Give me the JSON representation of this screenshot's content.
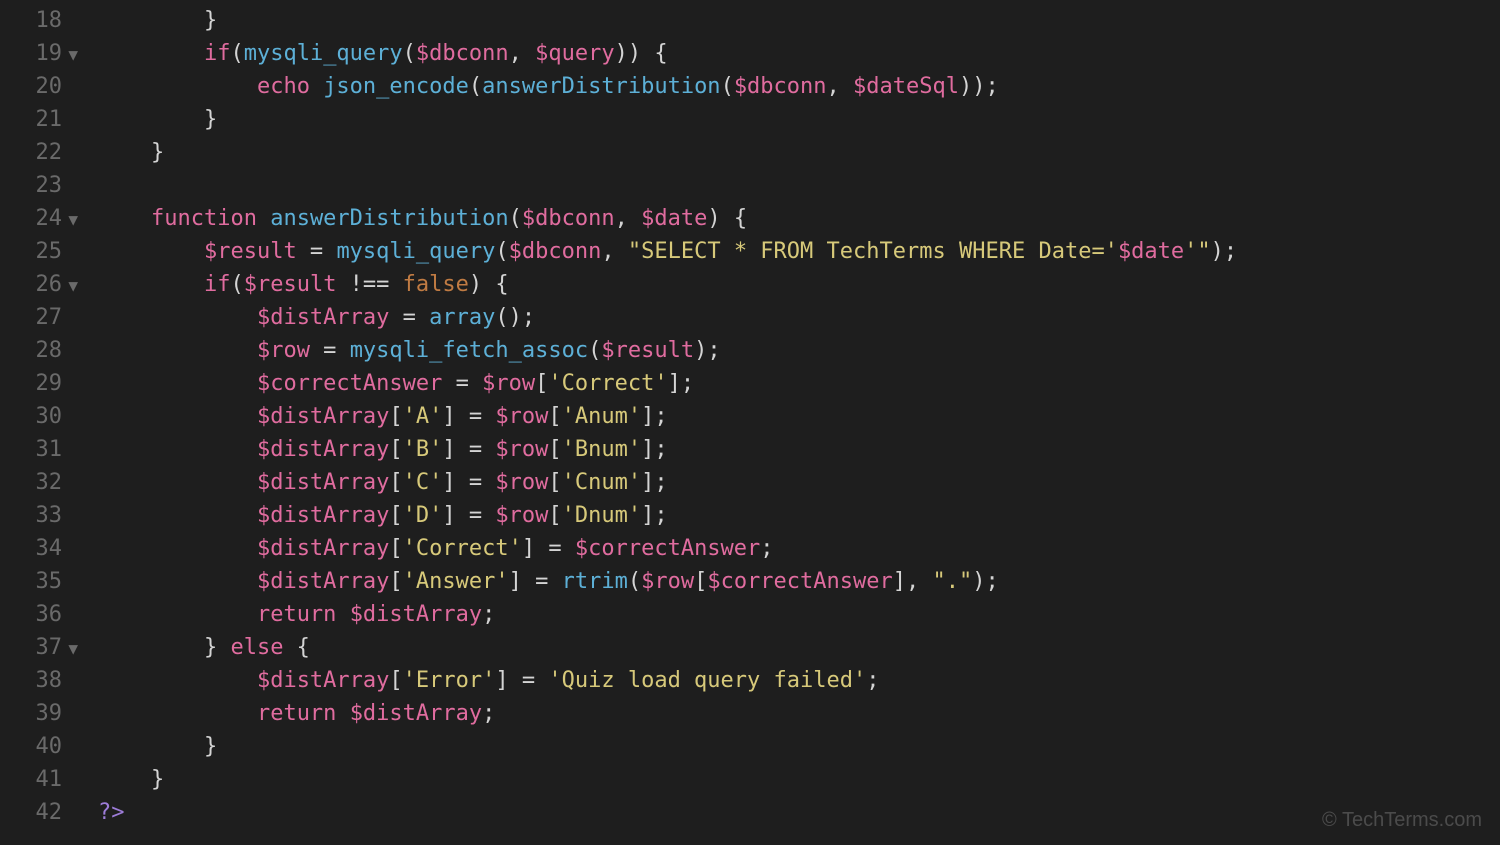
{
  "watermark": "© TechTerms.com",
  "gutter": [
    {
      "n": "18",
      "fold": ""
    },
    {
      "n": "19",
      "fold": "▼"
    },
    {
      "n": "20",
      "fold": ""
    },
    {
      "n": "21",
      "fold": ""
    },
    {
      "n": "22",
      "fold": ""
    },
    {
      "n": "23",
      "fold": ""
    },
    {
      "n": "24",
      "fold": "▼"
    },
    {
      "n": "25",
      "fold": ""
    },
    {
      "n": "26",
      "fold": "▼"
    },
    {
      "n": "27",
      "fold": ""
    },
    {
      "n": "28",
      "fold": ""
    },
    {
      "n": "29",
      "fold": ""
    },
    {
      "n": "30",
      "fold": ""
    },
    {
      "n": "31",
      "fold": ""
    },
    {
      "n": "32",
      "fold": ""
    },
    {
      "n": "33",
      "fold": ""
    },
    {
      "n": "34",
      "fold": ""
    },
    {
      "n": "35",
      "fold": ""
    },
    {
      "n": "36",
      "fold": ""
    },
    {
      "n": "37",
      "fold": "▼"
    },
    {
      "n": "38",
      "fold": ""
    },
    {
      "n": "39",
      "fold": ""
    },
    {
      "n": "40",
      "fold": ""
    },
    {
      "n": "41",
      "fold": ""
    },
    {
      "n": "42",
      "fold": ""
    }
  ],
  "lines": [
    [
      {
        "t": "        }",
        "c": "tok-default"
      }
    ],
    [
      {
        "t": "        ",
        "c": "tok-default"
      },
      {
        "t": "if",
        "c": "tok-keyword"
      },
      {
        "t": "(",
        "c": "tok-punct"
      },
      {
        "t": "mysqli_query",
        "c": "tok-func"
      },
      {
        "t": "(",
        "c": "tok-punct"
      },
      {
        "t": "$dbconn",
        "c": "tok-var"
      },
      {
        "t": ", ",
        "c": "tok-punct"
      },
      {
        "t": "$query",
        "c": "tok-var"
      },
      {
        "t": ")) {",
        "c": "tok-punct"
      }
    ],
    [
      {
        "t": "            ",
        "c": "tok-default"
      },
      {
        "t": "echo",
        "c": "tok-keyword"
      },
      {
        "t": " ",
        "c": "tok-default"
      },
      {
        "t": "json_encode",
        "c": "tok-func"
      },
      {
        "t": "(",
        "c": "tok-punct"
      },
      {
        "t": "answerDistribution",
        "c": "tok-func"
      },
      {
        "t": "(",
        "c": "tok-punct"
      },
      {
        "t": "$dbconn",
        "c": "tok-var"
      },
      {
        "t": ", ",
        "c": "tok-punct"
      },
      {
        "t": "$dateSql",
        "c": "tok-var"
      },
      {
        "t": "));",
        "c": "tok-punct"
      }
    ],
    [
      {
        "t": "        }",
        "c": "tok-default"
      }
    ],
    [
      {
        "t": "    }",
        "c": "tok-default"
      }
    ],
    [
      {
        "t": "",
        "c": "tok-default"
      }
    ],
    [
      {
        "t": "    ",
        "c": "tok-default"
      },
      {
        "t": "function",
        "c": "tok-keyword"
      },
      {
        "t": " ",
        "c": "tok-default"
      },
      {
        "t": "answerDistribution",
        "c": "tok-funcdef"
      },
      {
        "t": "(",
        "c": "tok-punct"
      },
      {
        "t": "$dbconn",
        "c": "tok-var"
      },
      {
        "t": ", ",
        "c": "tok-punct"
      },
      {
        "t": "$date",
        "c": "tok-var"
      },
      {
        "t": ") {",
        "c": "tok-punct"
      }
    ],
    [
      {
        "t": "        ",
        "c": "tok-default"
      },
      {
        "t": "$result",
        "c": "tok-var"
      },
      {
        "t": " = ",
        "c": "tok-op"
      },
      {
        "t": "mysqli_query",
        "c": "tok-func"
      },
      {
        "t": "(",
        "c": "tok-punct"
      },
      {
        "t": "$dbconn",
        "c": "tok-var"
      },
      {
        "t": ", ",
        "c": "tok-punct"
      },
      {
        "t": "\"SELECT * FROM TechTerms WHERE Date='",
        "c": "tok-string"
      },
      {
        "t": "$date",
        "c": "tok-var"
      },
      {
        "t": "'\"",
        "c": "tok-string"
      },
      {
        "t": ");",
        "c": "tok-punct"
      }
    ],
    [
      {
        "t": "        ",
        "c": "tok-default"
      },
      {
        "t": "if",
        "c": "tok-keyword"
      },
      {
        "t": "(",
        "c": "tok-punct"
      },
      {
        "t": "$result",
        "c": "tok-var"
      },
      {
        "t": " !== ",
        "c": "tok-op"
      },
      {
        "t": "false",
        "c": "tok-const"
      },
      {
        "t": ") {",
        "c": "tok-punct"
      }
    ],
    [
      {
        "t": "            ",
        "c": "tok-default"
      },
      {
        "t": "$distArray",
        "c": "tok-var"
      },
      {
        "t": " = ",
        "c": "tok-op"
      },
      {
        "t": "array",
        "c": "tok-func"
      },
      {
        "t": "();",
        "c": "tok-punct"
      }
    ],
    [
      {
        "t": "            ",
        "c": "tok-default"
      },
      {
        "t": "$row",
        "c": "tok-var"
      },
      {
        "t": " = ",
        "c": "tok-op"
      },
      {
        "t": "mysqli_fetch_assoc",
        "c": "tok-func"
      },
      {
        "t": "(",
        "c": "tok-punct"
      },
      {
        "t": "$result",
        "c": "tok-var"
      },
      {
        "t": ");",
        "c": "tok-punct"
      }
    ],
    [
      {
        "t": "            ",
        "c": "tok-default"
      },
      {
        "t": "$correctAnswer",
        "c": "tok-var"
      },
      {
        "t": " = ",
        "c": "tok-op"
      },
      {
        "t": "$row",
        "c": "tok-var"
      },
      {
        "t": "[",
        "c": "tok-punct"
      },
      {
        "t": "'Correct'",
        "c": "tok-string"
      },
      {
        "t": "];",
        "c": "tok-punct"
      }
    ],
    [
      {
        "t": "            ",
        "c": "tok-default"
      },
      {
        "t": "$distArray",
        "c": "tok-var"
      },
      {
        "t": "[",
        "c": "tok-punct"
      },
      {
        "t": "'A'",
        "c": "tok-string"
      },
      {
        "t": "] = ",
        "c": "tok-op"
      },
      {
        "t": "$row",
        "c": "tok-var"
      },
      {
        "t": "[",
        "c": "tok-punct"
      },
      {
        "t": "'Anum'",
        "c": "tok-string"
      },
      {
        "t": "];",
        "c": "tok-punct"
      }
    ],
    [
      {
        "t": "            ",
        "c": "tok-default"
      },
      {
        "t": "$distArray",
        "c": "tok-var"
      },
      {
        "t": "[",
        "c": "tok-punct"
      },
      {
        "t": "'B'",
        "c": "tok-string"
      },
      {
        "t": "] = ",
        "c": "tok-op"
      },
      {
        "t": "$row",
        "c": "tok-var"
      },
      {
        "t": "[",
        "c": "tok-punct"
      },
      {
        "t": "'Bnum'",
        "c": "tok-string"
      },
      {
        "t": "];",
        "c": "tok-punct"
      }
    ],
    [
      {
        "t": "            ",
        "c": "tok-default"
      },
      {
        "t": "$distArray",
        "c": "tok-var"
      },
      {
        "t": "[",
        "c": "tok-punct"
      },
      {
        "t": "'C'",
        "c": "tok-string"
      },
      {
        "t": "] = ",
        "c": "tok-op"
      },
      {
        "t": "$row",
        "c": "tok-var"
      },
      {
        "t": "[",
        "c": "tok-punct"
      },
      {
        "t": "'Cnum'",
        "c": "tok-string"
      },
      {
        "t": "];",
        "c": "tok-punct"
      }
    ],
    [
      {
        "t": "            ",
        "c": "tok-default"
      },
      {
        "t": "$distArray",
        "c": "tok-var"
      },
      {
        "t": "[",
        "c": "tok-punct"
      },
      {
        "t": "'D'",
        "c": "tok-string"
      },
      {
        "t": "] = ",
        "c": "tok-op"
      },
      {
        "t": "$row",
        "c": "tok-var"
      },
      {
        "t": "[",
        "c": "tok-punct"
      },
      {
        "t": "'Dnum'",
        "c": "tok-string"
      },
      {
        "t": "];",
        "c": "tok-punct"
      }
    ],
    [
      {
        "t": "            ",
        "c": "tok-default"
      },
      {
        "t": "$distArray",
        "c": "tok-var"
      },
      {
        "t": "[",
        "c": "tok-punct"
      },
      {
        "t": "'Correct'",
        "c": "tok-string"
      },
      {
        "t": "] = ",
        "c": "tok-op"
      },
      {
        "t": "$correctAnswer",
        "c": "tok-var"
      },
      {
        "t": ";",
        "c": "tok-punct"
      }
    ],
    [
      {
        "t": "            ",
        "c": "tok-default"
      },
      {
        "t": "$distArray",
        "c": "tok-var"
      },
      {
        "t": "[",
        "c": "tok-punct"
      },
      {
        "t": "'Answer'",
        "c": "tok-string"
      },
      {
        "t": "] = ",
        "c": "tok-op"
      },
      {
        "t": "rtrim",
        "c": "tok-func"
      },
      {
        "t": "(",
        "c": "tok-punct"
      },
      {
        "t": "$row",
        "c": "tok-var"
      },
      {
        "t": "[",
        "c": "tok-punct"
      },
      {
        "t": "$correctAnswer",
        "c": "tok-var"
      },
      {
        "t": "], ",
        "c": "tok-punct"
      },
      {
        "t": "\".\"",
        "c": "tok-string"
      },
      {
        "t": ");",
        "c": "tok-punct"
      }
    ],
    [
      {
        "t": "            ",
        "c": "tok-default"
      },
      {
        "t": "return",
        "c": "tok-keyword"
      },
      {
        "t": " ",
        "c": "tok-default"
      },
      {
        "t": "$distArray",
        "c": "tok-var"
      },
      {
        "t": ";",
        "c": "tok-punct"
      }
    ],
    [
      {
        "t": "        } ",
        "c": "tok-default"
      },
      {
        "t": "else",
        "c": "tok-keyword"
      },
      {
        "t": " {",
        "c": "tok-punct"
      }
    ],
    [
      {
        "t": "            ",
        "c": "tok-default"
      },
      {
        "t": "$distArray",
        "c": "tok-var"
      },
      {
        "t": "[",
        "c": "tok-punct"
      },
      {
        "t": "'Error'",
        "c": "tok-string"
      },
      {
        "t": "] = ",
        "c": "tok-op"
      },
      {
        "t": "'Quiz load query failed'",
        "c": "tok-string"
      },
      {
        "t": ";",
        "c": "tok-punct"
      }
    ],
    [
      {
        "t": "            ",
        "c": "tok-default"
      },
      {
        "t": "return",
        "c": "tok-keyword"
      },
      {
        "t": " ",
        "c": "tok-default"
      },
      {
        "t": "$distArray",
        "c": "tok-var"
      },
      {
        "t": ";",
        "c": "tok-punct"
      }
    ],
    [
      {
        "t": "        }",
        "c": "tok-default"
      }
    ],
    [
      {
        "t": "    }",
        "c": "tok-default"
      }
    ],
    [
      {
        "t": "?>",
        "c": "tok-phptag"
      }
    ]
  ]
}
